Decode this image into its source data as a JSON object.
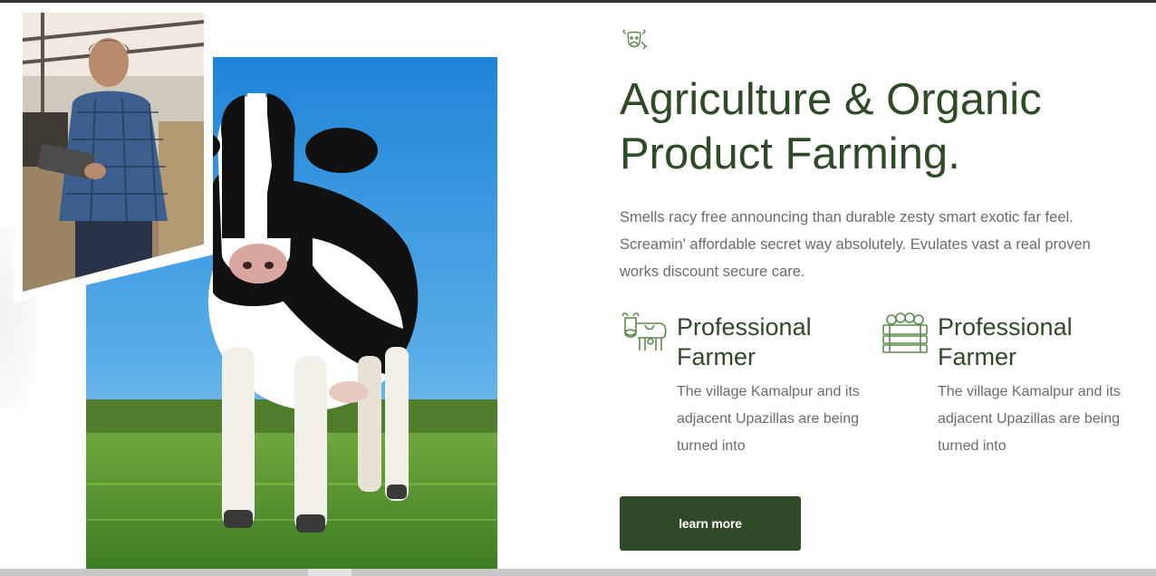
{
  "section": {
    "title_line1": "Agriculture & Organic",
    "title_line2": "Product Farming.",
    "description": "Smells racy free announcing than durable zesty smart exotic far feel. Screamin' affordable secret way absolutely. Evulates vast a real proven works discount secure care.",
    "top_icon": "cow-head-icon",
    "features": [
      {
        "icon": "cow-icon",
        "heading_line1": "Professional",
        "heading_line2": "Farmer",
        "text": "The village Kamalpur and its adjacent Upazillas are being turned into"
      },
      {
        "icon": "vegetable-crate-icon",
        "heading_line1": "Professional",
        "heading_line2": "Farmer",
        "text": "The village Kamalpur and its adjacent Upazillas are being turned into"
      }
    ],
    "button_label": "learn more"
  },
  "images": {
    "main": "cow-in-field-photo",
    "inset": "farmer-with-tablet-photo"
  },
  "colors": {
    "accent": "#2e4a27",
    "body_text": "#6b6b6b",
    "icon_green": "#5d8a4e"
  }
}
